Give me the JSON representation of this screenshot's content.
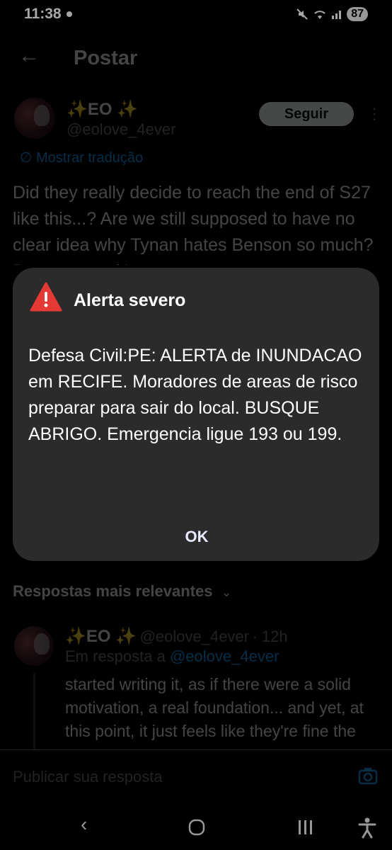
{
  "status_bar": {
    "time": "11:38",
    "battery": "87"
  },
  "header": {
    "title": "Postar"
  },
  "post": {
    "author_name": "✨EO ✨",
    "author_handle": "@eolove_4ever",
    "follow_label": "Seguir",
    "translate_label": "Mostrar tradução",
    "text": "Did they really decide to reach the end of S27 like this...? Are we still supposed to have no clear idea why Tynan hates Benson so much? Because no, it's not"
  },
  "replies_sort_label": "Respostas mais relevantes",
  "reply": {
    "author_name": "✨EO ✨",
    "author_handle": "@eolove_4ever",
    "time": "· 12h",
    "in_reply_prefix": "Em resposta a",
    "in_reply_handle": "@eolove_4ever",
    "text": "started writing it, as if there were a solid motivation, a real foundation... and yet, at this point, it just feels like they're fine the end of tension"
  },
  "composer": {
    "placeholder": "Publicar sua resposta"
  },
  "alert": {
    "title": "Alerta severo",
    "message": "Defesa Civil:PE: ALERTA de INUNDACAO em RECIFE. Moradores de areas de risco preparar para sair do local. BUSQUE ABRIGO. Emergencia ligue 193 ou 199.",
    "ok_label": "OK"
  },
  "icons": {
    "back": "arrow-left-icon",
    "warning": "warning-triangle-icon",
    "camera": "camera-icon",
    "more": "more-vertical-icon"
  },
  "colors": {
    "accent": "#1d9bf0",
    "warning": "#e53935",
    "dialog": "#2b2b2b"
  }
}
